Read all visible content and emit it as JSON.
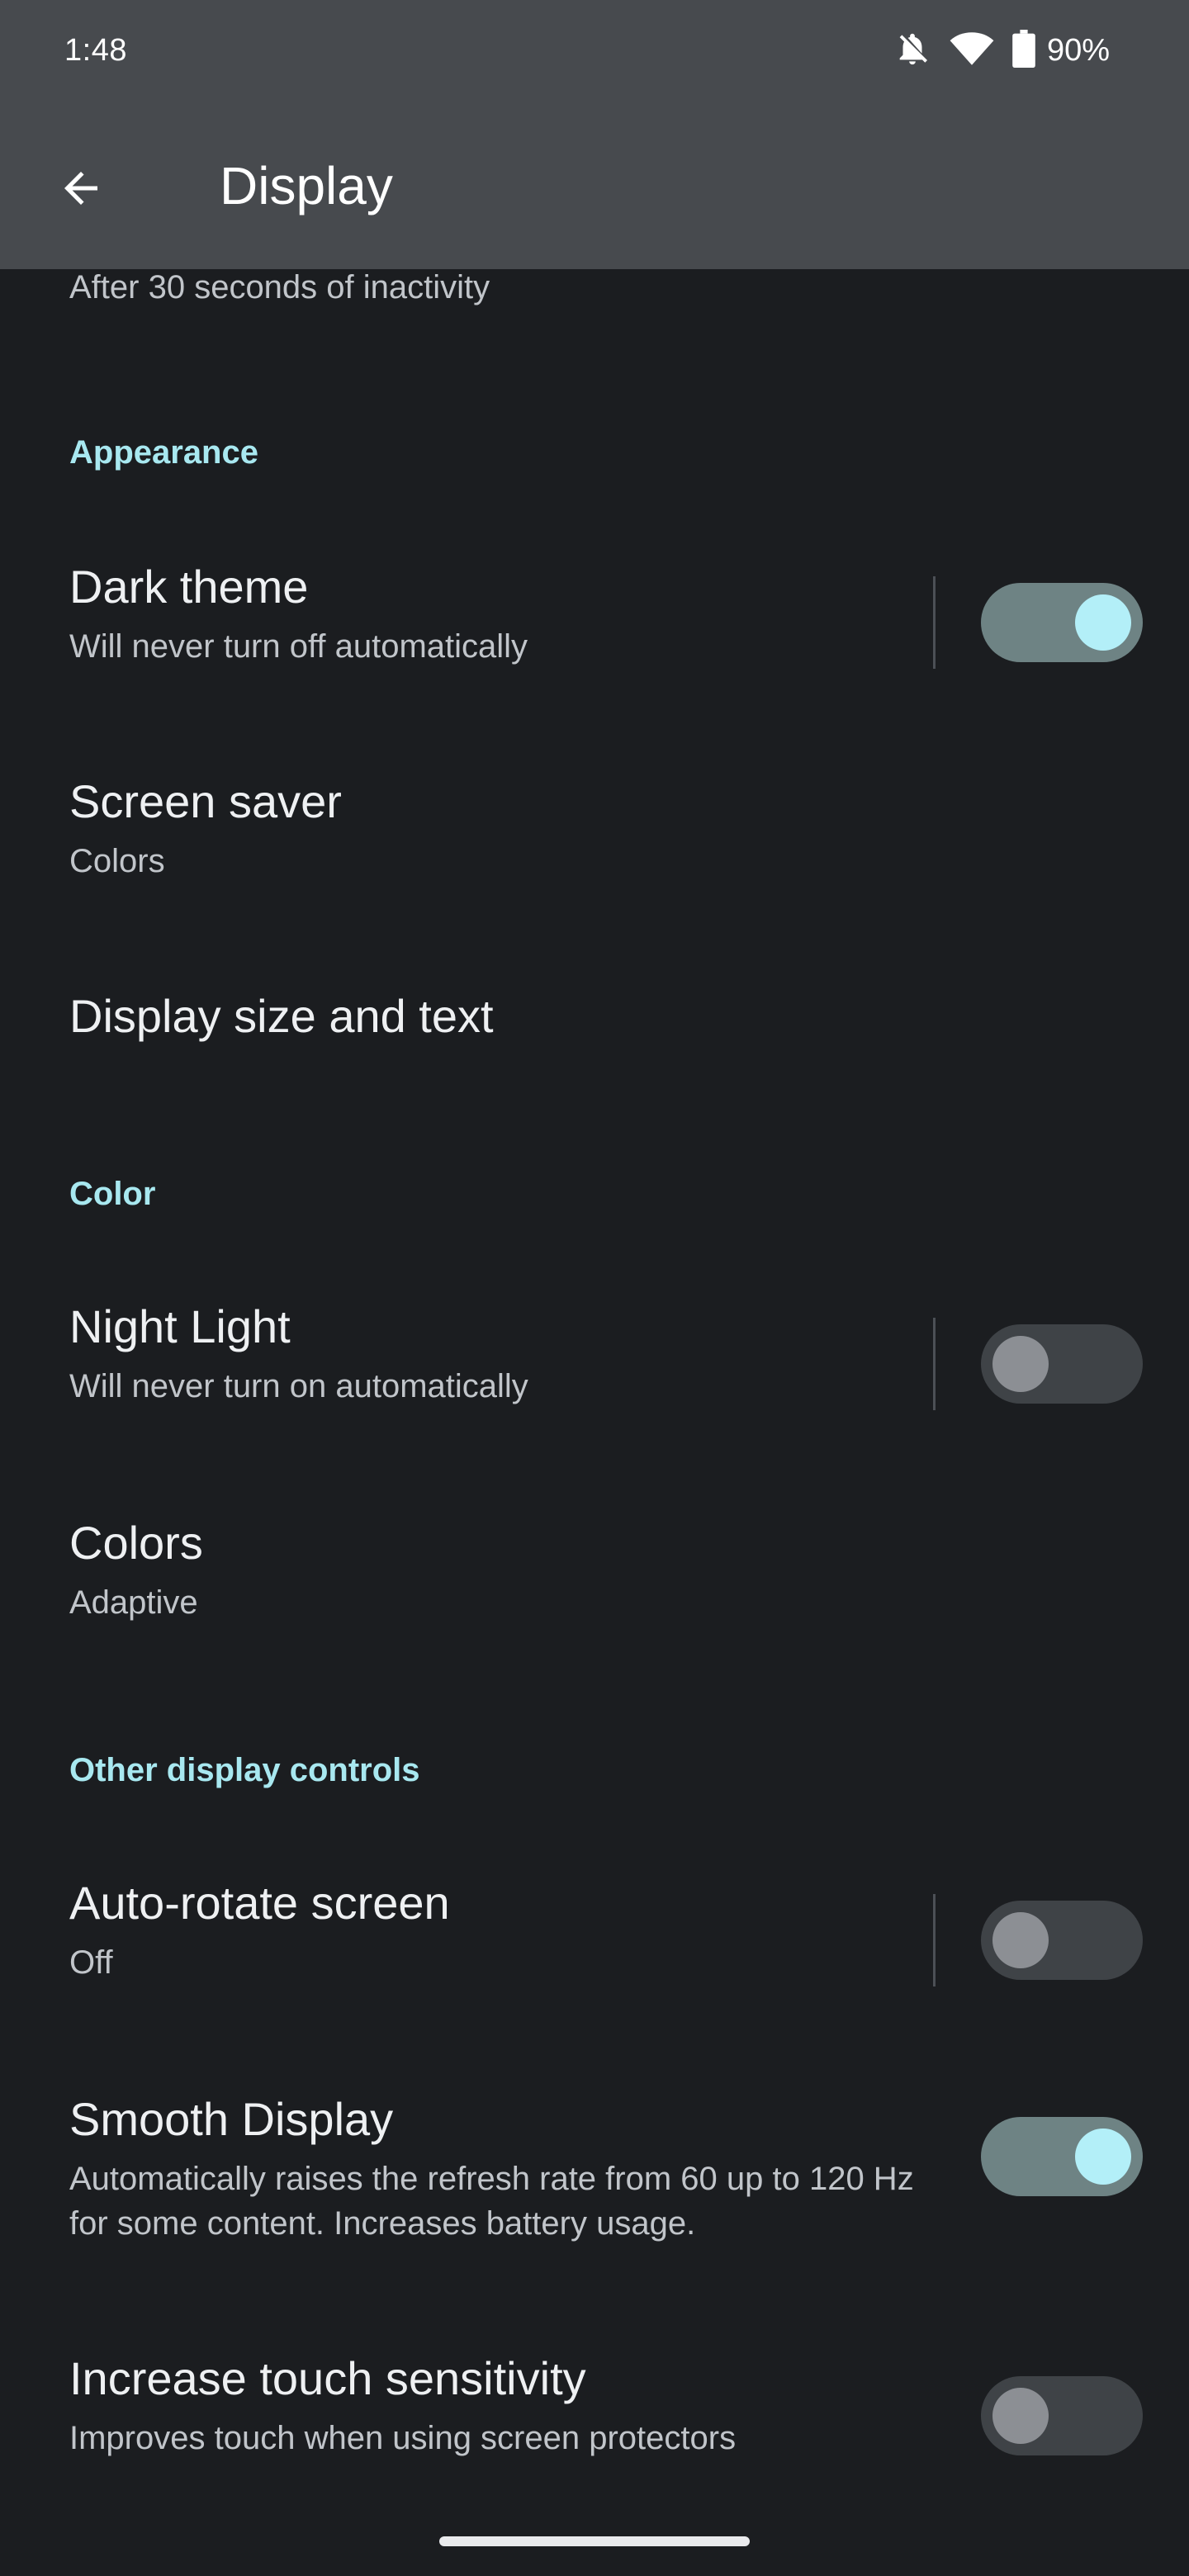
{
  "status_bar": {
    "time": "1:48",
    "icons": [
      "notifications-off-icon",
      "wifi-icon",
      "battery-icon"
    ],
    "battery": "90%"
  },
  "app_bar": {
    "back_icon": "arrow-back-icon",
    "title": "Display"
  },
  "truncated_item": {
    "summary": "After 30 seconds of inactivity"
  },
  "sections": {
    "appearance": {
      "header": "Appearance",
      "dark_theme": {
        "title": "Dark theme",
        "summary": "Will never turn off automatically",
        "toggle_on": true
      },
      "screen_saver": {
        "title": "Screen saver",
        "summary": "Colors"
      },
      "display_size": {
        "title": "Display size and text"
      }
    },
    "color": {
      "header": "Color",
      "night_light": {
        "title": "Night Light",
        "summary": "Will never turn on automatically",
        "toggle_on": false
      },
      "colors": {
        "title": "Colors",
        "summary": "Adaptive"
      }
    },
    "other": {
      "header": "Other display controls",
      "auto_rotate": {
        "title": "Auto-rotate screen",
        "summary": "Off",
        "toggle_on": false
      },
      "smooth_display": {
        "title": "Smooth Display",
        "summary": "Automatically raises the refresh rate from 60 up to 120 Hz for some content. Increases battery usage.",
        "toggle_on": true
      },
      "touch_sensitivity": {
        "title": "Increase touch sensitivity",
        "summary": "Improves touch when using screen protectors",
        "toggle_on": false
      }
    }
  },
  "colors": {
    "background": "#1b1d20",
    "app_bar": "#474a4e",
    "accent": "#a8e8f0",
    "switch_on_track": "#6e8384",
    "switch_on_thumb": "#b3eff8",
    "switch_off_track": "#3f4347",
    "switch_off_thumb": "#8c8f94"
  }
}
